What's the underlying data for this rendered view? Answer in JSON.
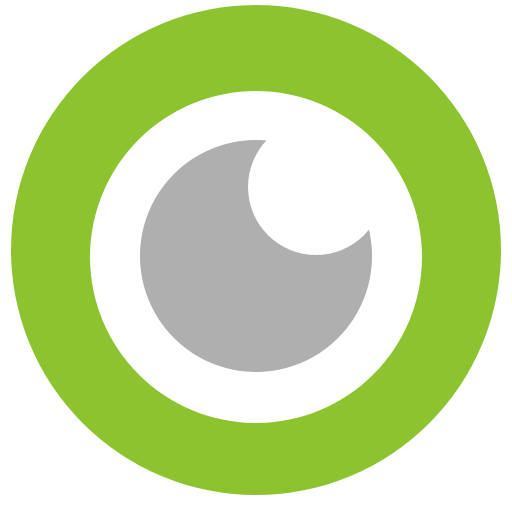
{
  "icon": {
    "name": "eye-icon",
    "colors": {
      "ring": "#8dc32f",
      "inner": "#ffffff",
      "pupil": "#afafaf",
      "highlight": "#ffffff",
      "background": "#ffffff"
    }
  }
}
